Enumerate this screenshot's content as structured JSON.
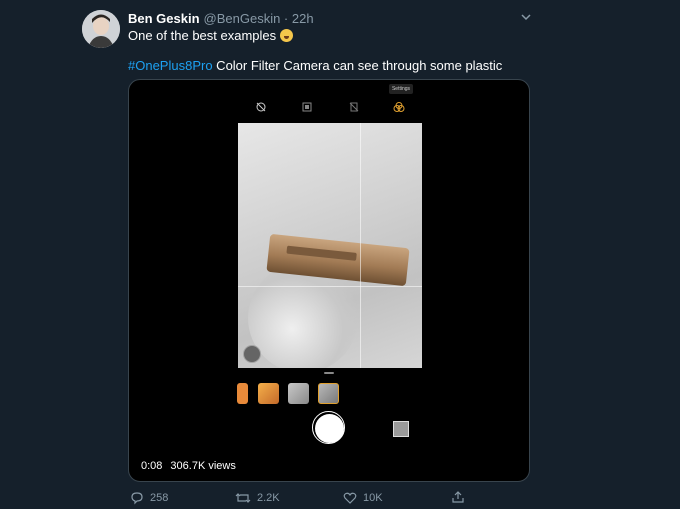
{
  "tweet": {
    "author_name": "Ben Geskin",
    "author_handle": "@BenGeskin · 22h",
    "text_line1": "One of the best examples",
    "hashtag": "#OnePlus8Pro",
    "text_line2": " Color Filter Camera can see through some plastic"
  },
  "video": {
    "tooltip": "Settings",
    "time": "0:08",
    "views": "306.7K views"
  },
  "actions": {
    "reply_count": "258",
    "retweet_count": "2.2K",
    "like_count": "10K"
  },
  "icons": {
    "caret": "chevron-down-icon",
    "reply": "reply-icon",
    "retweet": "retweet-icon",
    "like": "heart-icon",
    "share": "share-icon"
  },
  "colors": {
    "background": "#15202b",
    "hashtag": "#1da1f2",
    "muted": "#8899a6"
  }
}
